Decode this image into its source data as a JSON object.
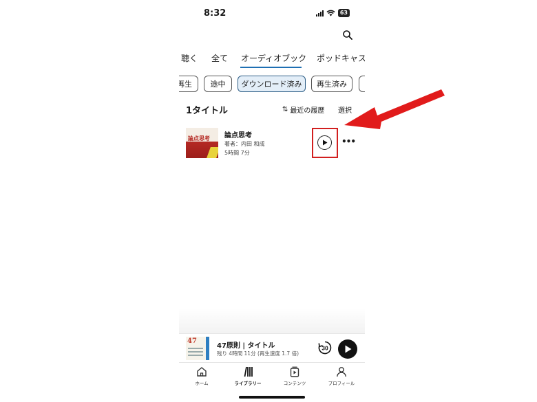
{
  "status_bar": {
    "time": "8:32",
    "battery": "63"
  },
  "tabs": [
    {
      "label": "聴く",
      "active": false
    },
    {
      "label": "全て",
      "active": false
    },
    {
      "label": "オーディオブック",
      "active": true
    },
    {
      "label": "ポッドキャスト",
      "active": false
    }
  ],
  "filters": [
    {
      "label": "再生",
      "active": false
    },
    {
      "label": "途中",
      "active": false
    },
    {
      "label": "ダウンロード済み",
      "active": true
    },
    {
      "label": "再生済み",
      "active": false
    }
  ],
  "list_header": {
    "count": "1タイトル",
    "sort_label": "最近の履歴",
    "select_label": "選択"
  },
  "items": [
    {
      "title": "論点思考",
      "author": "著者：内田 和成",
      "duration": "5時間 7分",
      "cover_text": "論点思考"
    }
  ],
  "mini_player": {
    "title": "47原則 | タイトル",
    "subtitle": "残り 4時間 11分 (再生速度 1.7 倍)",
    "skip_seconds": "30",
    "cover_text": "47"
  },
  "bottom_nav": [
    {
      "label": "ホーム",
      "icon": "home-icon",
      "active": false
    },
    {
      "label": "ライブラリー",
      "icon": "library-icon",
      "active": true
    },
    {
      "label": "コンテンツ",
      "icon": "content-icon",
      "active": false
    },
    {
      "label": "プロフィール",
      "icon": "profile-icon",
      "active": false
    }
  ],
  "colors": {
    "accent": "#1e6fb3",
    "annotation_red": "#d21f1f",
    "chip_active_bg": "#e3eef8"
  }
}
